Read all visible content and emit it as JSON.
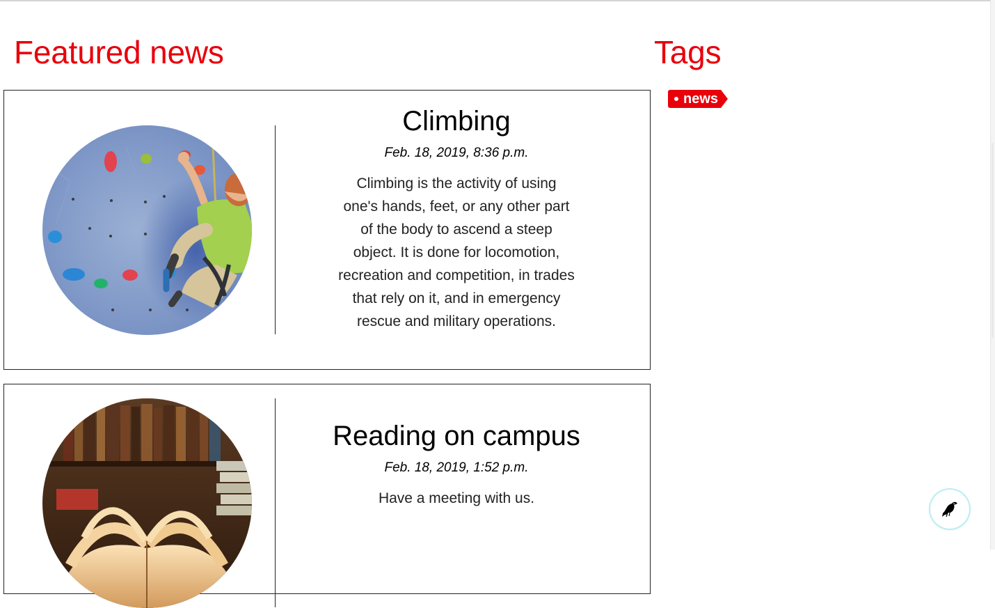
{
  "page": {
    "featured_title": "Featured news",
    "tags_title": "Tags"
  },
  "tags": [
    {
      "label": "news"
    }
  ],
  "articles": [
    {
      "title": "Climbing",
      "date": "Feb. 18, 2019, 8:36 p.m.",
      "body": "Climbing is the activity of using one's hands, feet, or any other part of the body to ascend a steep object. It is done for locomotion, recreation and competition, in trades that rely on it, and in emergency rescue and military operations.",
      "image_icon": "rock-climbing-photo"
    },
    {
      "title": "Reading on campus",
      "date": "Feb. 18, 2019, 1:52 p.m.",
      "body": "Have a meeting with us.",
      "image_icon": "open-book-library-photo"
    }
  ],
  "floating_button": {
    "icon": "bird-icon"
  },
  "colors": {
    "accent": "#e8000b",
    "border": "#222222",
    "floating_ring": "#b8eef4"
  }
}
